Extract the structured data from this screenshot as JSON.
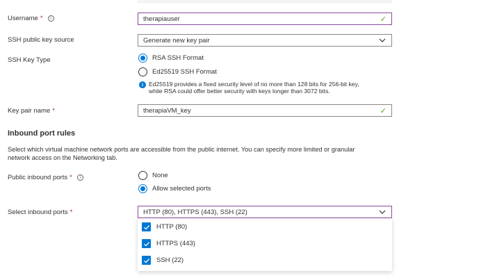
{
  "username": {
    "label": "Username",
    "required_mark": "*",
    "info_icon": "info-circle-icon",
    "value": "therapiauser",
    "status_icon": "checkmark-icon"
  },
  "ssh_source": {
    "label": "SSH public key source",
    "value": "Generate new key pair",
    "dropdown_icon": "chevron-down-icon"
  },
  "ssh_key_type": {
    "label": "SSH Key Type",
    "options": [
      {
        "label": "RSA SSH Format",
        "selected": true
      },
      {
        "label": "Ed25519 SSH Format",
        "selected": false
      }
    ],
    "info_line1": "Ed25519 provides a fixed security level of no more than 128 bits for 256-bit key,",
    "info_line2": "while RSA could offer better security with keys longer than 3072 bits.",
    "info_icon": "info-filled-icon"
  },
  "key_pair_name": {
    "label": "Key pair name",
    "required_mark": "*",
    "value": "therapiaVM_key",
    "status_icon": "checkmark-icon"
  },
  "inbound": {
    "title": "Inbound port rules",
    "desc_line1": "Select which virtual machine network ports are accessible from the public internet. You can specify more limited or granular",
    "desc_line2": "network access on the Networking tab."
  },
  "public_ports": {
    "label": "Public inbound ports",
    "required_mark": "*",
    "info_icon": "info-circle-icon",
    "options": [
      {
        "label": "None",
        "selected": false
      },
      {
        "label": "Allow selected ports",
        "selected": true
      }
    ]
  },
  "select_ports": {
    "label": "Select inbound ports",
    "required_mark": "*",
    "value": "HTTP (80), HTTPS (443), SSH (22)",
    "dropdown_icon": "chevron-down-icon",
    "options": [
      {
        "label": "HTTP (80)",
        "checked": true
      },
      {
        "label": "HTTPS (443)",
        "checked": true
      },
      {
        "label": "SSH (22)",
        "checked": true
      }
    ]
  },
  "colors": {
    "accent": "#0078d4",
    "focus_border": "#8a4a9a",
    "valid": "#57a300",
    "required": "#a4262c"
  }
}
